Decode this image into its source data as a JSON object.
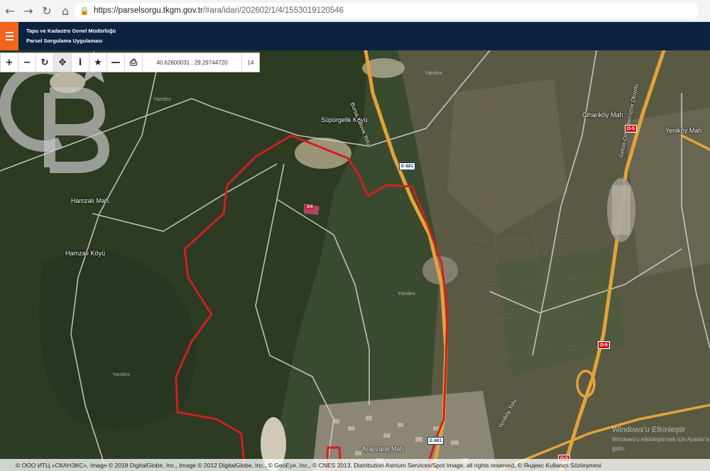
{
  "browser": {
    "back_icon": "back-arrow-icon",
    "forward_icon": "forward-arrow-icon",
    "reload_icon": "reload-icon",
    "home_icon": "home-icon",
    "url_host": "https://parselsorgu.tkgm.gov.tr",
    "url_path": "/#ara/idari/202602/1/4/1553019120546"
  },
  "header": {
    "org_name": "Tapu ve Kadastro Genel Müdürlüğü",
    "app_name": "Parsel Sorgulama Uygulaması",
    "accent_color": "#f2641e",
    "bg_color": "#0c2340"
  },
  "toolbar": {
    "tools": [
      "zoom-in-icon",
      "zoom-out-icon",
      "refresh-icon",
      "pan-icon",
      "info-icon",
      "favorite-icon",
      "measure-icon",
      "print-icon"
    ],
    "coordinates": "40.62600031 : 29.29744720",
    "zoom_level": "14"
  },
  "map": {
    "place_labels": {
      "supurgelik": "Süpürgelik Köyü",
      "hamzali_mah": "Hamzalı Mah.",
      "hamzali_koyu": "Hamzalı Köyü",
      "cihankoy": "Cihanköy Mah",
      "yenikoy": "Yeniköy Mah",
      "arapzade": "Arapzade Mah",
      "bursa_yalova": "Bursa Yalova Yolu",
      "gebze_izmir": "Gebze-Orhangazi-İzmir Otoyolu",
      "yenikoy_yolu": "Yeniköy Yolu",
      "yandex1": "Yandex",
      "yandex2": "Yandex",
      "yandex3": "Yandex",
      "yandex4": "Yandex"
    },
    "road_shields": {
      "e881_top": "E-881",
      "e881_bottom": "E-881",
      "o5_top": "O-5",
      "o5_mid": "O-5",
      "o5_bottom": "O-5"
    },
    "parcel_tag": "1/4",
    "parcel_color": "#d0201e",
    "watermark": "Windows'u Etkinleştir",
    "watermark_sub": "Windows'u etkinleştirmek için Ayarlar'a gidin.",
    "attribution": "© ООО ИТЦ «СКАНЭКС», Image © 2018 DigitalGlobe, Inc., Image © 2012 DigitalGlobe, Inc., © GeoEye, Inc., © CNES 2013, Distribution Astrium Services/Spot Image, all rights reserved, © Яндекс Kullanıcı Sözleşmesi"
  }
}
